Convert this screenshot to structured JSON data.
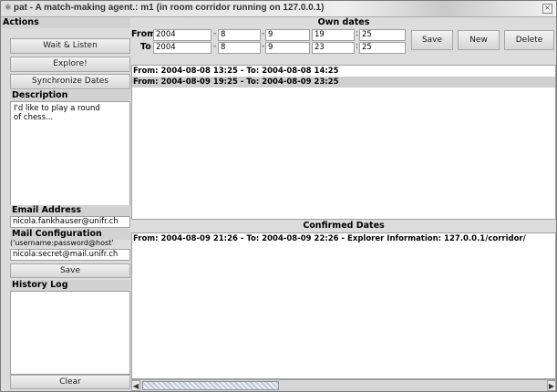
{
  "window": {
    "title": "pat - A match-making agent.: m1 (in room corridor running on 127.0.0.1)"
  },
  "actions": {
    "header": "Actions",
    "wait_listen": "Wait & Listen",
    "explore": "Explore!",
    "sync": "Synchronize Dates"
  },
  "description": {
    "header": "Description",
    "text": "I'd like to play a round\nof chess..."
  },
  "email": {
    "header": "Email Address",
    "value": "nicola.fankhauser@unifr.ch"
  },
  "mail_config": {
    "header": "Mail Configuration",
    "hint": "('username:password@host'",
    "value": "nicola:secret@mail.unifr.ch",
    "save": "Save"
  },
  "history": {
    "header": "History Log",
    "clear": "Clear"
  },
  "own_dates": {
    "header": "Own dates",
    "from_label": "From",
    "to_label": "To",
    "from": {
      "year": "2004",
      "month": "8",
      "day": "9",
      "hour": "19",
      "minute": "25"
    },
    "to": {
      "year": "2004",
      "month": "8",
      "day": "9",
      "hour": "23",
      "minute": "25"
    },
    "sep_dash": "-",
    "sep_colon": ":",
    "buttons": {
      "save": "Save",
      "new": "New",
      "delete": "Delete"
    },
    "list": [
      "From: 2004-08-08 13:25  -  To: 2004-08-08 14:25",
      "From: 2004-08-09 19:25  -  To: 2004-08-09 23:25"
    ]
  },
  "confirmed": {
    "header": "Confirmed Dates",
    "list": [
      "From: 2004-08-09 21:26  -  To: 2004-08-09 22:26  -  Explorer Information: 127.0.0.1/corridor/"
    ]
  },
  "scrollbar": {
    "left_arrow": "◀",
    "right_arrow": "▶"
  },
  "icons": {
    "window": "pin-icon",
    "close": "close-icon"
  }
}
